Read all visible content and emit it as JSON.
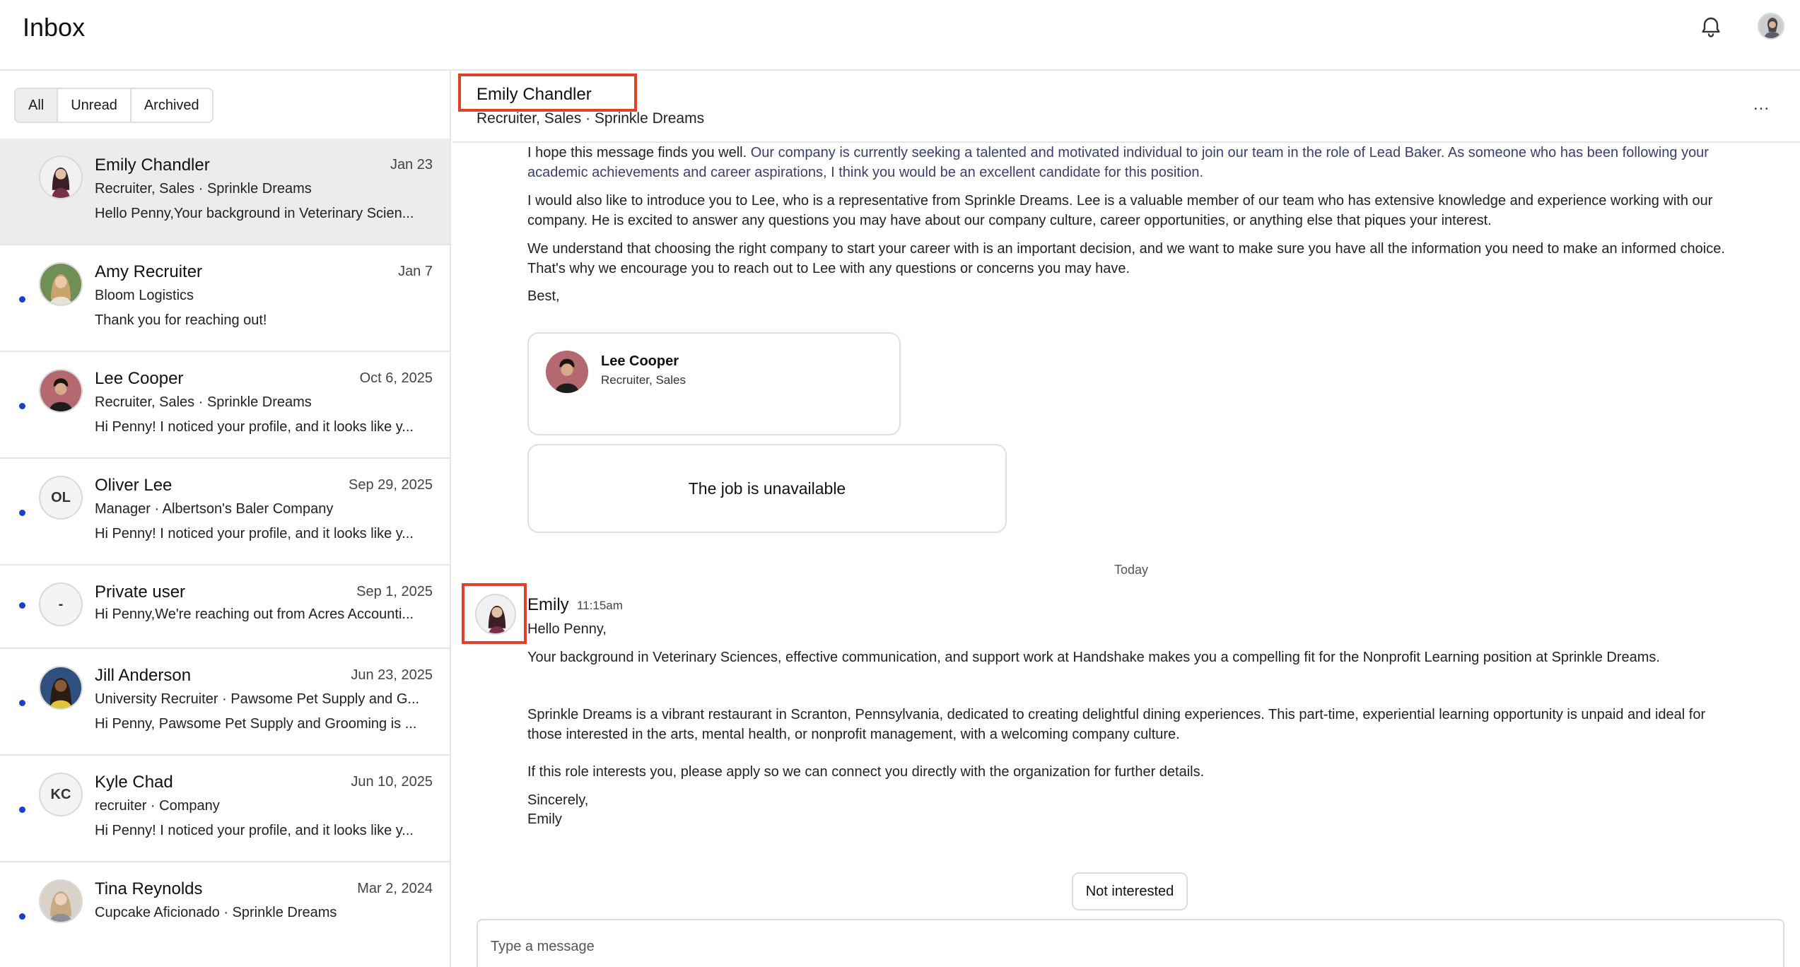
{
  "app": {
    "title": "Inbox"
  },
  "filters": [
    "All",
    "Unread",
    "Archived"
  ],
  "conversations": [
    {
      "name": "Emily Chandler",
      "date": "Jan 23",
      "subtitle": "Recruiter, Sales · Sprinkle Dreams",
      "preview": "Hello Penny,Your background in Veterinary Scien...",
      "initials": ""
    },
    {
      "name": "Amy Recruiter",
      "date": "Jan 7",
      "subtitle": "Bloom Logistics",
      "preview": "Thank you for reaching out!",
      "initials": ""
    },
    {
      "name": "Lee Cooper",
      "date": "Oct 6, 2025",
      "subtitle": "Recruiter, Sales · Sprinkle Dreams",
      "preview": "Hi Penny! I noticed your profile, and it looks like y...",
      "initials": ""
    },
    {
      "name": "Oliver Lee",
      "date": "Sep 29, 2025",
      "subtitle": "Manager · Albertson's Baler Company",
      "preview": "Hi Penny! I noticed your profile, and it looks like y...",
      "initials": "OL"
    },
    {
      "name": "Private user",
      "date": "Sep 1, 2025",
      "subtitle": "",
      "preview": "Hi Penny,We're reaching out from Acres Accounti...",
      "initials": "-"
    },
    {
      "name": "Jill Anderson",
      "date": "Jun 23, 2025",
      "subtitle": "University Recruiter · Pawsome Pet Supply and G...",
      "preview": "Hi Penny, Pawsome Pet Supply and Grooming is ...",
      "initials": ""
    },
    {
      "name": "Kyle Chad",
      "date": "Jun 10, 2025",
      "subtitle": "recruiter · Company",
      "preview": "Hi Penny! I noticed your profile, and it looks like y...",
      "initials": "KC"
    },
    {
      "name": "Tina Reynolds",
      "date": "Mar 2, 2024",
      "subtitle": "Cupcake Aficionado · Sprinkle Dreams",
      "preview": "",
      "initials": ""
    }
  ],
  "thread": {
    "name": "Emily Chandler",
    "subtitle": "Recruiter, Sales · Sprinkle Dreams",
    "more": "...",
    "earlier_message": {
      "p1_start": "I hope this message finds you well. ",
      "p1_rest": "Our company is currently seeking a talented and motivated individual to join our team in the role of Lead Baker. As someone who has been following your academic achievements and career aspirations, I think you would be an excellent candidate for this position.",
      "p2": "I would also like to introduce you to Lee, who is a representative from Sprinkle Dreams. Lee is a valuable member of our team who has extensive knowledge and experience working with our company. He is excited to answer any questions you may have about our company culture, career opportunities, or anything else that piques your interest.",
      "p3": "We understand that choosing the right company to start your career with is an important decision, and we want to make sure you have all the information you need to make an informed choice. That's why we encourage you to reach out to Lee with any questions or concerns you may have.",
      "sign": "Best,"
    },
    "profile_card": {
      "name": "Lee Cooper",
      "title": "Recruiter, Sales"
    },
    "job_card": "The job is unavailable",
    "day_separator": "Today",
    "latest_message": {
      "sender": "Emily",
      "time": "11:15am",
      "greeting": "Hello Penny,",
      "p1": "Your background in Veterinary Sciences, effective communication, and support work at Handshake makes you a compelling fit for the Nonprofit Learning position at Sprinkle Dreams.",
      "p2": "Sprinkle Dreams is a vibrant restaurant in Scranton, Pennsylvania, dedicated to creating delightful dining experiences. This part-time, experiential learning opportunity is unpaid and ideal for those interested in the arts, mental health, or nonprofit management, with a welcoming company culture.",
      "p3": "If this role interests you, please apply so we can connect you directly with the organization for further details.",
      "closing": "Sincerely,",
      "signature": "Emily"
    },
    "not_interested": "Not interested",
    "composer_placeholder": "Type a message"
  },
  "colors": {
    "unread_dot": "#1a3fcc",
    "highlight_border": "#e0412a",
    "selected_bg": "#ececec"
  },
  "icons": [
    "bell-icon",
    "user-avatar",
    "more-options-icon"
  ]
}
